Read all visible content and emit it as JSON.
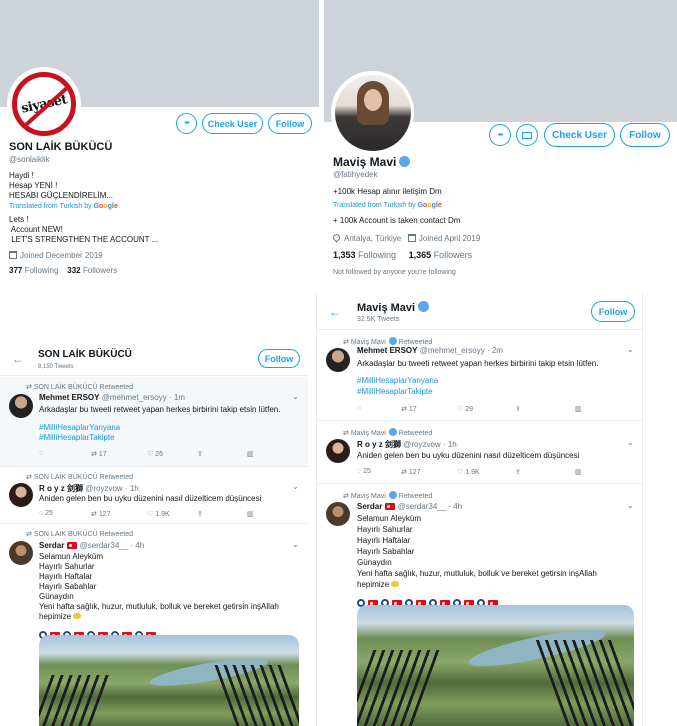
{
  "colors": {
    "accent": "#1da1f2",
    "cover": "#cdd3d8",
    "muted": "#657786"
  },
  "profile_left": {
    "logo_text": "siyaset",
    "more_label": "•••",
    "check_user": "Check User",
    "follow": "Follow",
    "name": "SON LAİK BÜKÜCÜ",
    "handle": "@sonlaiklik",
    "bio_lines": [
      "Haydi !",
      "Hesap YENİ !",
      "HESABI  GÜÇLENDİRELİM..."
    ],
    "translated_from": "Translated from Turkish by",
    "google": "Google",
    "translation_lines": [
      "Lets !",
      " Account NEW!",
      " LET'S STRENGTHEN THE ACCOUNT ..."
    ],
    "joined": "Joined December 2019",
    "following_count": "377",
    "following_label": "Following",
    "followers_count": "332",
    "followers_label": "Followers"
  },
  "profile_right": {
    "more_label": "•••",
    "mail_icon": "mail-icon",
    "check_user": "Check User",
    "follow": "Follow",
    "name": "Maviş Mavi",
    "handle": "@fatihyedek",
    "bio": "+100k Hesap alınır iletişim Dm",
    "translated_from": "Translated from Turkish by",
    "google": "Google",
    "translation": "+ 100k Account is taken contact Dm",
    "location": "Antalya, Türkiye",
    "joined": "Joined April 2019",
    "following_count": "1,353",
    "following_label": "Following",
    "followers_count": "1,365",
    "followers_label": "Followers",
    "not_followed": "Not followed by anyone you're following"
  },
  "timeline_left": {
    "title": "SON LAİK BÜKÜCÜ",
    "subtitle": "8,150 Tweets",
    "follow": "Follow",
    "tweets": [
      {
        "retweeted_by": "SON LAİK BÜKÜCÜ Retweeted",
        "name": "Mehmet ERSOY",
        "handle": "@mehmet_ersoyy · 1m",
        "text": "Arkadaşlar bu tweeti retweet yapan herkes birbirini takip etsin lütfen.",
        "hashtags": [
          "#MilliHesaplarYanyana",
          "#MilliHesaplarTakipte"
        ],
        "retweets": "17",
        "likes": "26"
      },
      {
        "retweeted_by": "SON LAİK BÜKÜCÜ Retweeted",
        "name": "R o y z 剑獅",
        "handle": "@royzvow · 1h",
        "text": "Aniden gelen ben bu uyku düzenini nasıl düzelticem düşüncesi",
        "replies": "25",
        "retweets": "127",
        "likes": "1.9K"
      },
      {
        "retweeted_by": "SON LAİK BÜKÜCÜ Retweeted",
        "name": "Serdar",
        "handle": "@serdar34__ · 4h",
        "lines": [
          "Selamun Aleyküm",
          "Hayırlı Sahurlar",
          "Hayırlı Haftalar",
          "Hayırlı Sabahlar",
          "Günaydın",
          "Yeni hafta sağlık, huzur, mutluluk, bolluk ve bereket getirsin inşAllah",
          "hepimize"
        ]
      }
    ]
  },
  "timeline_right": {
    "title": "Maviş Mavi",
    "subtitle": "32.5K Tweets",
    "follow": "Follow",
    "tweets": [
      {
        "retweeted_by": "Maviş Mavi",
        "retweeted_suffix": "Retweeted",
        "name": "Mehmet ERSOY",
        "handle": "@mehmet_ersoyy · 2m",
        "text": "Arkadaşlar bu tweeti retweet yapan herkes birbirini takip etsin lütfen.",
        "hashtags": [
          "#MilliHesaplarYanyana",
          "#MilliHesaplarTakipte"
        ],
        "retweets": "17",
        "likes": "29"
      },
      {
        "retweeted_by": "Maviş Mavi",
        "retweeted_suffix": "Retweeted",
        "name": "R o y z 剑獅",
        "handle": "@royzvow · 1h",
        "text": "Aniden gelen ben bu uyku düzenini nasıl düzelticem düşüncesi",
        "replies": "25",
        "retweets": "127",
        "likes": "1.9K"
      },
      {
        "retweeted_by": "Maviş Mavi",
        "retweeted_suffix": "Retweeted",
        "name": "Serdar",
        "handle": "@serdar34__ · 4h",
        "lines": [
          "Selamun Aleyküm",
          "Hayırlı Sahurlar",
          "Hayırlı Haftalar",
          "Hayırlı Sabahlar",
          "Günaydın",
          "Yeni hafta sağlık, huzur, mutluluk, bolluk ve bereket getirsin inşAllah",
          "hepimize"
        ]
      }
    ]
  }
}
